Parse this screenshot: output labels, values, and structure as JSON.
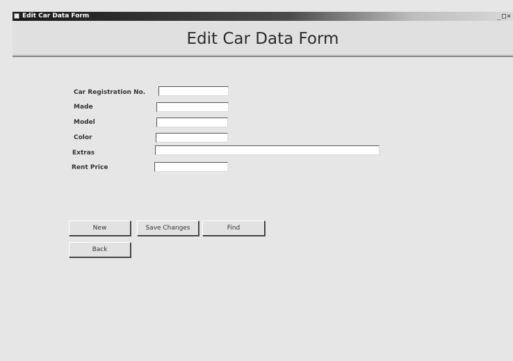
{
  "window": {
    "title": "Edit Car Data Form",
    "controls": {
      "minimize": "_",
      "maximize": "□",
      "close": "×"
    }
  },
  "form": {
    "title": "Edit Car Data Form",
    "fields": [
      {
        "label": "Car Registration No.",
        "value": ""
      },
      {
        "label": "Made",
        "value": ""
      },
      {
        "label": "Model",
        "value": ""
      },
      {
        "label": "Color",
        "value": ""
      },
      {
        "label": "Extras",
        "value": ""
      },
      {
        "label": "Rent Price",
        "value": ""
      }
    ]
  },
  "buttons": {
    "new": "New",
    "save_changes": "Save Changes",
    "find": "Find",
    "back": "Back"
  },
  "icons": {
    "app": "form-icon"
  }
}
